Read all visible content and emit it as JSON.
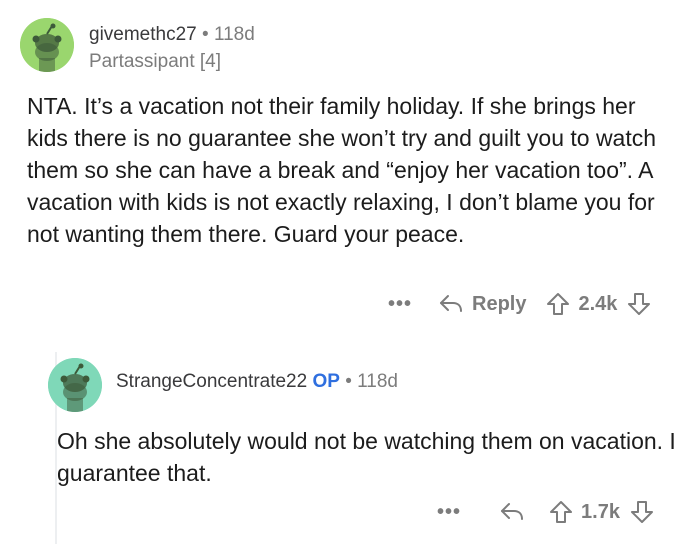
{
  "comment1": {
    "username": "givemethc27",
    "separator": "•",
    "time": "118d",
    "flair": "Partassipant [4]",
    "body": "NTA. It’s a vacation not their family holiday. If she brings her kids there is no guarantee she won’t try and guilt you to watch them so she can have a break and “enjoy her vacation too”. A vacation with kids is not exactly relaxing, I don’t blame you for not wanting them there. Guard your peace.",
    "more": "•••",
    "reply_label": "Reply",
    "score": "2.4k"
  },
  "comment2": {
    "username": "StrangeConcentrate22",
    "op_badge": "OP",
    "separator": "•",
    "time": "118d",
    "body": "Oh she absolutely would not be watching them on vacation. I guarantee that.",
    "more": "•••",
    "score": "1.7k"
  },
  "colors": {
    "avatar1": "#9ad66e",
    "avatar2": "#7fd8b8",
    "op_badge": "#2f6fdf",
    "meta": "#7c7c7c"
  },
  "icons": [
    "snoo-avatar-icon",
    "more-icon",
    "reply-arrow-icon",
    "upvote-arrow-icon",
    "downvote-arrow-icon"
  ]
}
